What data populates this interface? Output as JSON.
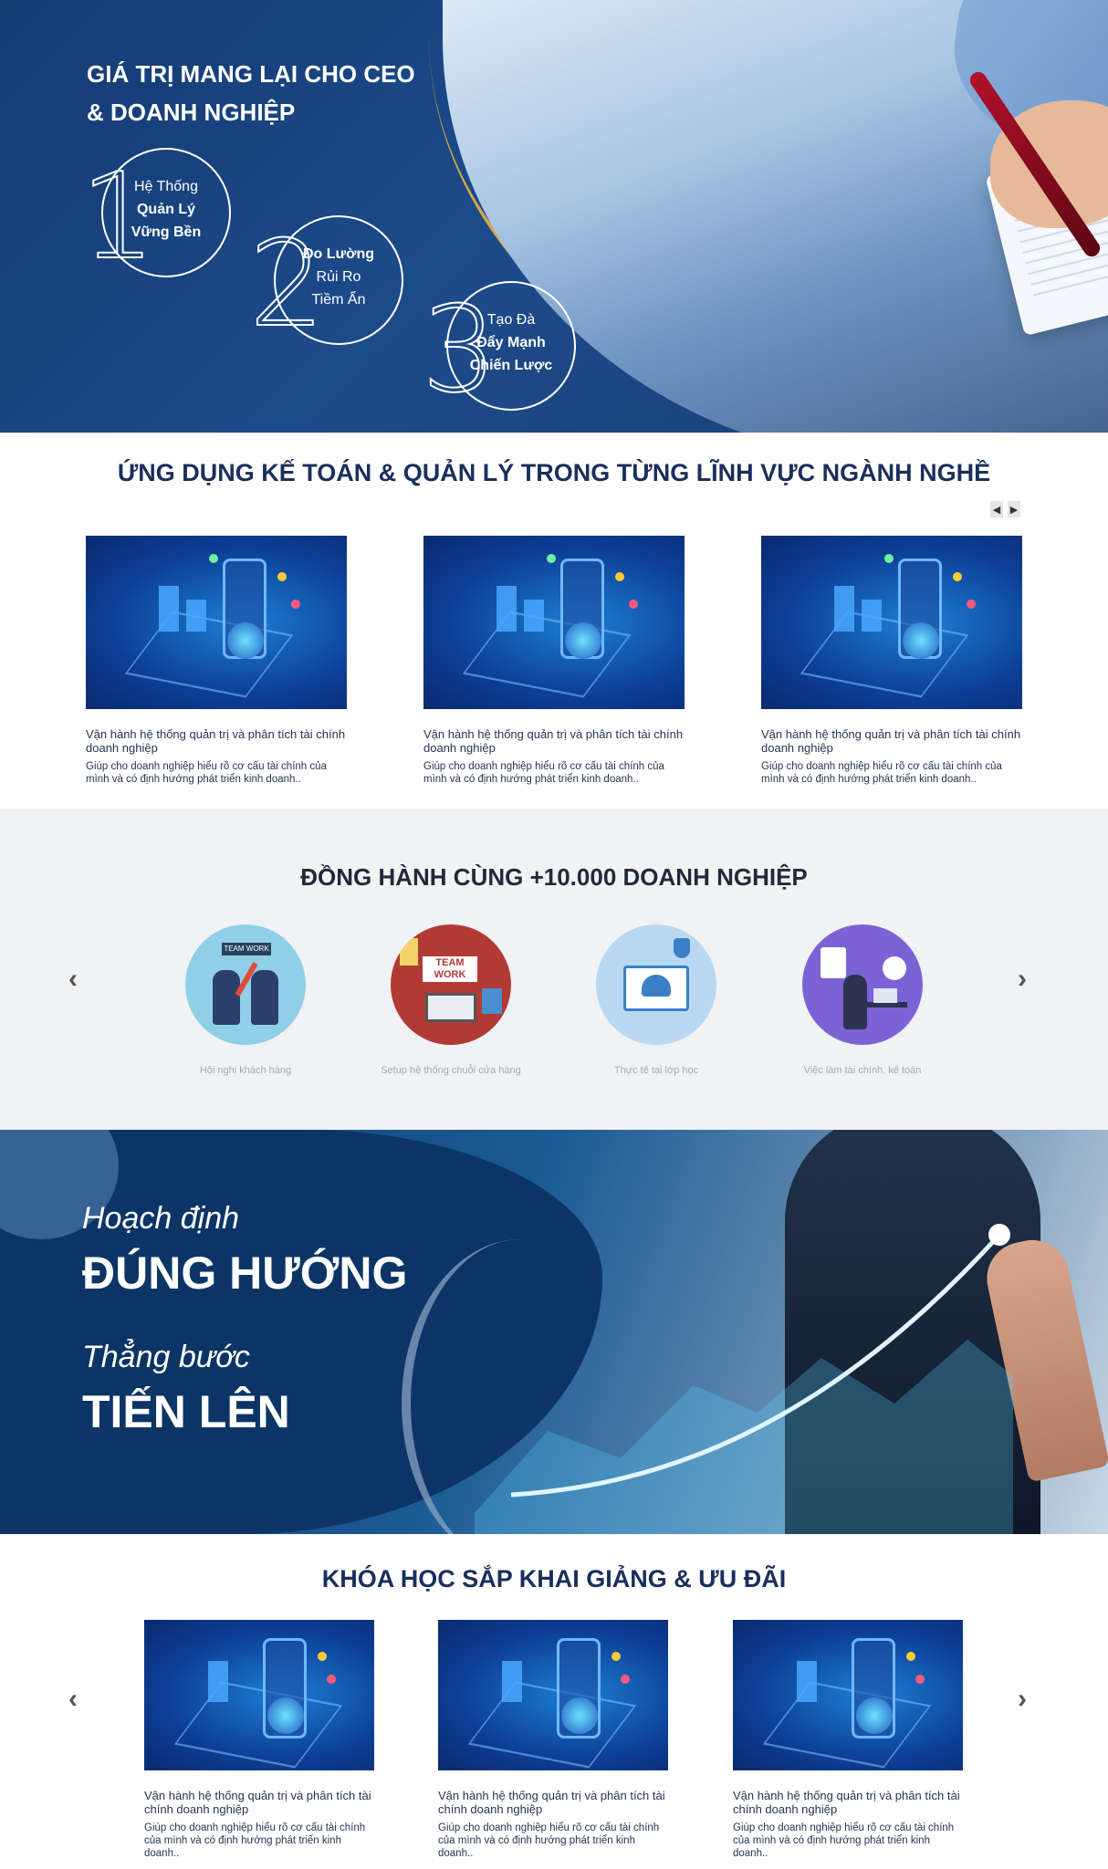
{
  "hero": {
    "title_line1": "GIÁ TRỊ MANG LẠI CHO CEO",
    "title_line2": "& DOANH NGHIỆP",
    "steps": [
      {
        "num": "1",
        "line1": "Hệ Thống",
        "line2": "Quản Lý",
        "line3": "Vững Bền"
      },
      {
        "num": "2",
        "line1": "Đo Lường",
        "line2": "Rủi Ro",
        "line3": "Tiềm Ẩn"
      },
      {
        "num": "3",
        "line1": "Tạo Đà",
        "line2": "Đẩy Mạnh",
        "line3": "Chiến Lược"
      }
    ],
    "colors": {
      "accent_gold": "#d3a74a",
      "navy": "#143a72"
    }
  },
  "applications": {
    "title": "ỨNG DỤNG KẾ TOÁN & QUẢN LÝ TRONG TỪNG LĨNH VỰC NGÀNH NGHỀ",
    "prev_icon": "chevron-left-icon",
    "next_icon": "chevron-right-icon",
    "cards": [
      {
        "title": "Vận hành hệ thống quản trị và phân tích tài chính doanh nghiệp",
        "desc": "Giúp cho doanh nghiệp hiểu rõ cơ cấu tài chính của mình và có định hướng phát triển kinh doanh.."
      },
      {
        "title": "Vận hành hệ thống quản trị và phân tích tài chính doanh nghiệp",
        "desc": "Giúp cho doanh nghiệp hiểu rõ cơ cấu tài chính của mình và có định hướng phát triển kinh doanh.."
      },
      {
        "title": "Vận hành hệ thống quản trị và phân tích tài chính doanh nghiệp",
        "desc": "Giúp cho doanh nghiệp hiểu rõ cơ cấu tài chính của mình và có định hướng phát triển kinh doanh.."
      }
    ]
  },
  "partners": {
    "title": "ĐỒNG HÀNH CÙNG +10.000 DOANH NGHIỆP",
    "items": [
      {
        "caption": "Hội nghị khách hàng",
        "badge": "TEAM WORK"
      },
      {
        "caption": "Setup hệ thống chuỗi cửa hàng",
        "badge": "TEAM WORK"
      },
      {
        "caption": "Thực tế tại lớp học"
      },
      {
        "caption": "Việc làm tài chính, kế toán"
      }
    ]
  },
  "banner": {
    "line1": "Hoạch định",
    "line2": "ĐÚNG HƯỚNG",
    "line3": "Thẳng bước",
    "line4": "TIẾN LÊN"
  },
  "courses": {
    "title": "KHÓA HỌC SẮP KHAI GIẢNG & ƯU ĐÃI",
    "cards": [
      {
        "title": "Vận hành hệ thống quản trị và phân tích tài chính doanh nghiệp",
        "desc": "Giúp cho doanh nghiệp hiểu rõ cơ cấu tài chính của mình và có định hướng phát triển kinh doanh.."
      },
      {
        "title": "Vận hành hệ thống quản trị và phân tích tài chính doanh nghiệp",
        "desc": "Giúp cho doanh nghiệp hiểu rõ cơ cấu tài chính của mình và có định hướng phát triển kinh doanh.."
      },
      {
        "title": "Vận hành hệ thống quản trị và phân tích tài chính doanh nghiệp",
        "desc": "Giúp cho doanh nghiệp hiểu rõ cơ cấu tài chính của mình và có định hướng phát triển kinh doanh.."
      }
    ]
  }
}
